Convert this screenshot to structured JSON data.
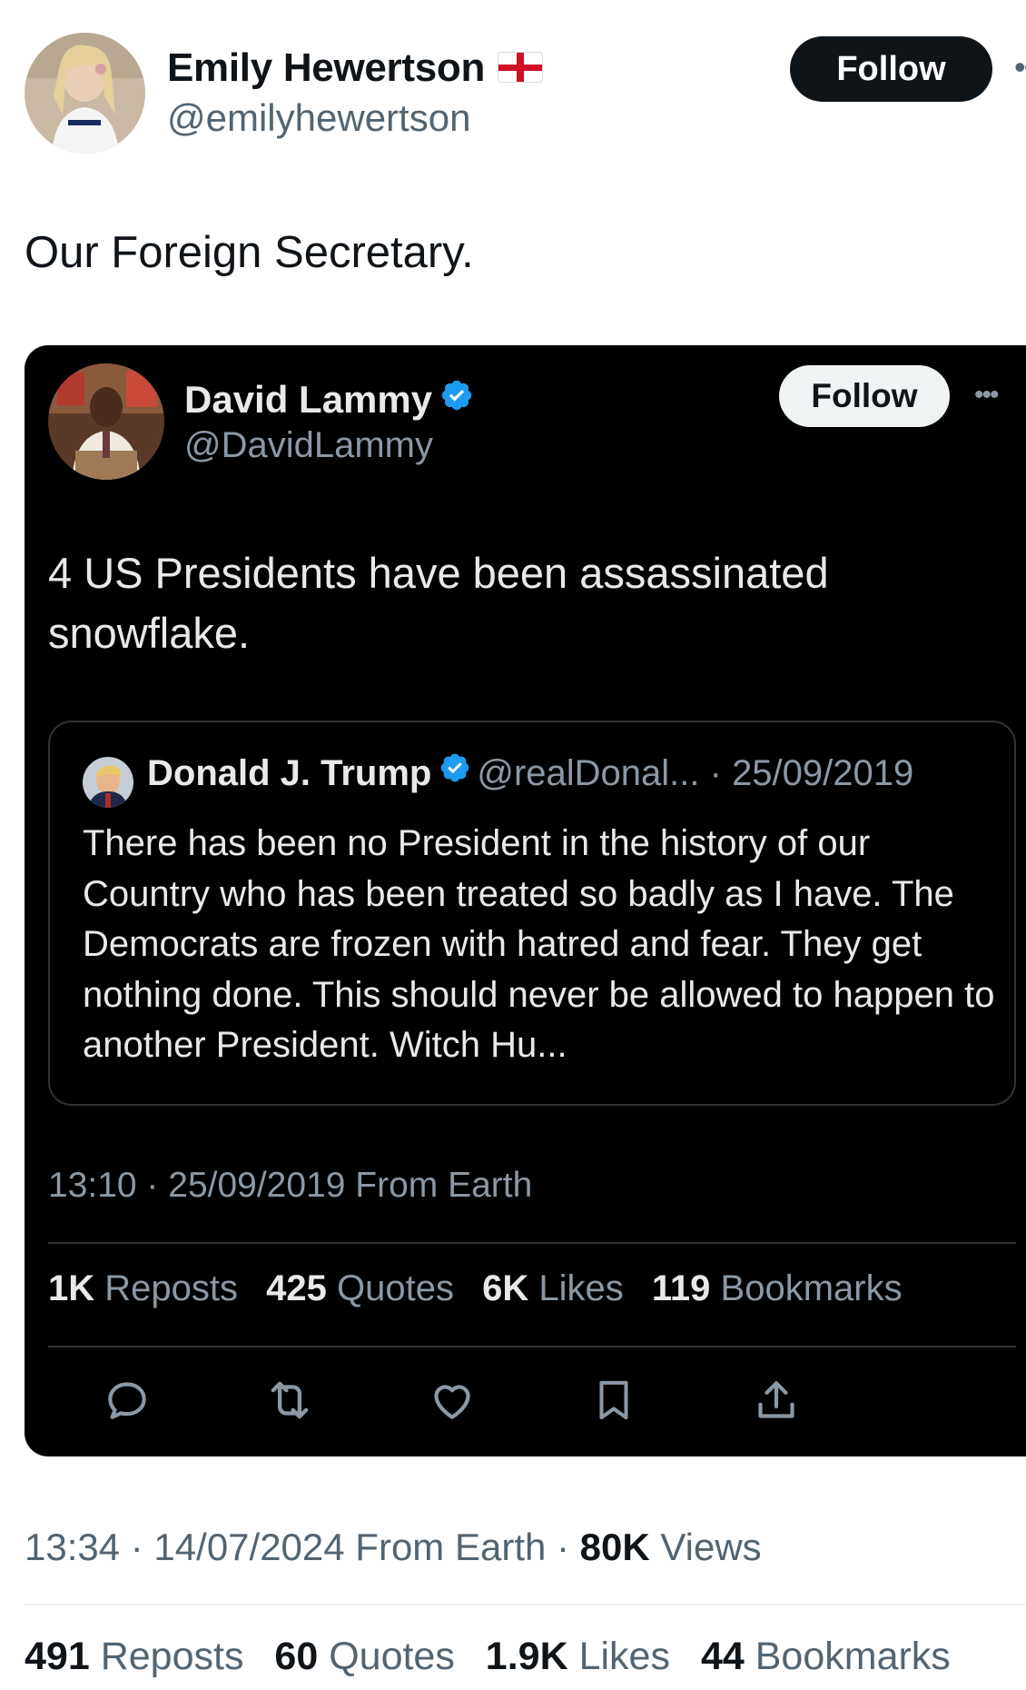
{
  "author": {
    "name": "Emily Hewertson",
    "handle": "@emilyhewertson",
    "follow_label": "Follow",
    "flag_icon": "england-flag-icon"
  },
  "tweet": {
    "text": "Our Foreign Secretary.",
    "time": "13:34 · 14/07/2024 From Earth · ",
    "views_count": "80K",
    "views_label": " Views"
  },
  "stats": {
    "reposts_count": "491",
    "reposts_label": "Reposts",
    "quotes_count": "60",
    "quotes_label": "Quotes",
    "likes_count": "1.9K",
    "likes_label": "Likes",
    "bookmarks_count": "44",
    "bookmarks_label": "Bookmarks"
  },
  "embedded": {
    "name": "David Lammy",
    "handle": "@DavidLammy",
    "follow_label": "Follow",
    "text": "4 US Presidents have been assassinated snowflake.",
    "time": "13:10 · 25/09/2019 From Earth",
    "stats": {
      "reposts_count": "1K",
      "reposts_label": "Reposts",
      "quotes_count": "425",
      "quotes_label": "Quotes",
      "likes_count": "6K",
      "likes_label": "Likes",
      "bookmarks_count": "119",
      "bookmarks_label": "Bookmarks"
    },
    "quoted": {
      "name": "Donald J. Trump",
      "meta": "@realDonal... · 25/09/2019",
      "text": "There has been no President in the history of our Country who has been treated so badly as I have. The Democrats are frozen with hatred and fear. They get nothing done. This should never be allowed to happen to another President. Witch Hu..."
    }
  },
  "colors": {
    "verified": "#1d9bf0",
    "card_bg": "#000000",
    "muted_light": "#536471",
    "muted_dark": "#8b98a5"
  }
}
